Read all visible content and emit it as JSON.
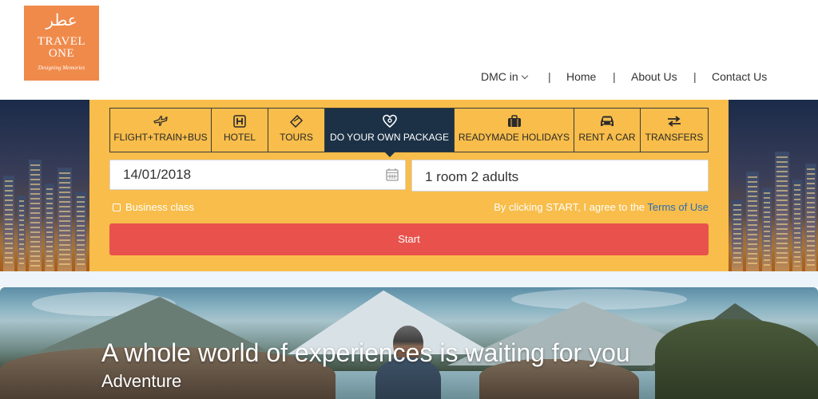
{
  "logo": {
    "name_line1": "TRAVEL",
    "name_line2": "ONE",
    "tagline": "Designing Memories",
    "brand_color": "#f08a4b"
  },
  "nav": {
    "items": [
      {
        "label": "DMC in",
        "has_dropdown": true
      },
      {
        "label": "Home"
      },
      {
        "label": "About Us"
      },
      {
        "label": "Contact Us"
      }
    ],
    "separator": "|"
  },
  "booking": {
    "panel_color": "#f8bd4a",
    "tabs": [
      {
        "label": "FLIGHT+TRAIN+BUS",
        "icon": "flight-train-bus-icon",
        "active": false
      },
      {
        "label": "HOTEL",
        "icon": "hotel-icon",
        "active": false
      },
      {
        "label": "TOURS",
        "icon": "ticket-icon",
        "active": false
      },
      {
        "label": "DO YOUR OWN PACKAGE",
        "icon": "package-icon",
        "active": true
      },
      {
        "label": "READYMADE HOLIDAYS",
        "icon": "suitcase-icon",
        "active": false
      },
      {
        "label": "RENT A CAR",
        "icon": "car-icon",
        "active": false
      },
      {
        "label": "TRANSFERS",
        "icon": "transfer-arrows-icon",
        "active": false
      }
    ],
    "date_value": "14/01/2018",
    "rooms_value": "1 room 2 adults",
    "business_class_label": "Business class",
    "terms_text": "By clicking START, I agree to the",
    "terms_link": "Terms of Use",
    "start_label": "Start",
    "start_color": "#e9524c",
    "active_tab_color": "#1c3146"
  },
  "feature": {
    "title": "A whole world of experiences is waiting for you",
    "subtitle": "Adventure"
  }
}
